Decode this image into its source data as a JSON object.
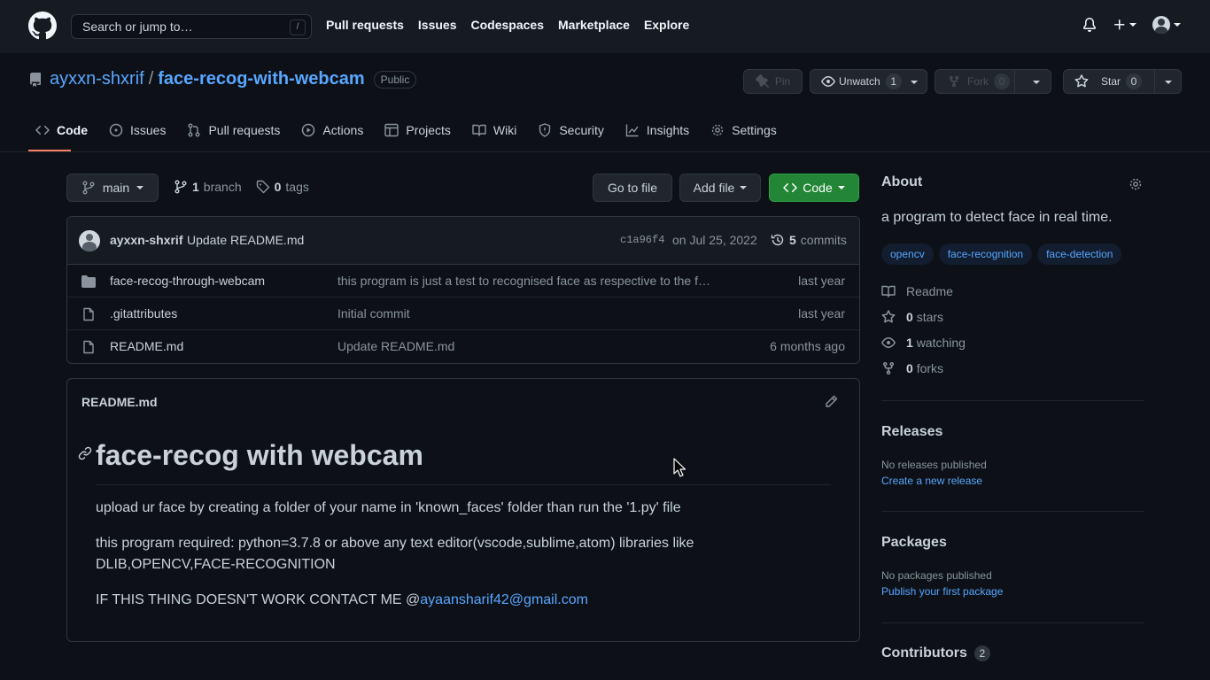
{
  "header": {
    "search_placeholder": "Search or jump to…",
    "search_shortcut": "/",
    "nav": [
      "Pull requests",
      "Issues",
      "Codespaces",
      "Marketplace",
      "Explore"
    ]
  },
  "repo": {
    "owner": "ayxxn-shxrif",
    "separator": "/",
    "name": "face-recog-with-webcam",
    "visibility": "Public",
    "pin_label": "Pin",
    "watch_label": "Unwatch",
    "watch_count": "1",
    "fork_label": "Fork",
    "fork_count": "0",
    "star_label": "Star",
    "star_count": "0"
  },
  "tabs": [
    {
      "label": "Code",
      "icon": "code-icon"
    },
    {
      "label": "Issues",
      "icon": "issue-icon"
    },
    {
      "label": "Pull requests",
      "icon": "pull-request-icon"
    },
    {
      "label": "Actions",
      "icon": "play-icon"
    },
    {
      "label": "Projects",
      "icon": "table-icon"
    },
    {
      "label": "Wiki",
      "icon": "book-icon"
    },
    {
      "label": "Security",
      "icon": "shield-icon"
    },
    {
      "label": "Insights",
      "icon": "graph-icon"
    },
    {
      "label": "Settings",
      "icon": "gear-icon"
    }
  ],
  "branchbar": {
    "branch": "main",
    "branch_count": "1",
    "branch_label": "branch",
    "tag_count": "0",
    "tag_label": "tags",
    "goto_label": "Go to file",
    "addfile_label": "Add file",
    "code_label": "Code"
  },
  "latest_commit": {
    "author": "ayxxn-shxrif",
    "message": "Update README.md",
    "sha": "c1a96f4",
    "date": "on Jul 25, 2022",
    "commit_count": "5",
    "commit_label": "commits"
  },
  "files": [
    {
      "type": "folder",
      "name": "face-recog-through-webcam",
      "message": "this program is just a test to recognised face as respective to the f…",
      "age": "last year"
    },
    {
      "type": "file",
      "name": ".gitattributes",
      "message": "Initial commit",
      "age": "last year"
    },
    {
      "type": "file",
      "name": "README.md",
      "message": "Update README.md",
      "age": "6 months ago"
    }
  ],
  "readme": {
    "filename": "README.md",
    "heading": "face-recog with webcam",
    "p1": "upload ur face by creating a folder of your name in 'known_faces' folder than run the '1.py' file",
    "p2": "this program required: python=3.7.8 or above any text editor(vscode,sublime,atom) libraries like DLIB,OPENCV,FACE-RECOGNITION",
    "p3_prefix": "IF THIS THING DOESN'T WORK CONTACT ME @",
    "p3_link": "ayaansharif42@gmail.com"
  },
  "about": {
    "title": "About",
    "description": "a program to detect face in real time.",
    "topics": [
      "opencv",
      "face-recognition",
      "face-detection"
    ],
    "readme_label": "Readme",
    "stars_count": "0",
    "stars_label": "stars",
    "watching_count": "1",
    "watching_label": "watching",
    "forks_count": "0",
    "forks_label": "forks"
  },
  "releases": {
    "title": "Releases",
    "empty": "No releases published",
    "link": "Create a new release"
  },
  "packages": {
    "title": "Packages",
    "empty": "No packages published",
    "link": "Publish your first package"
  },
  "contributors": {
    "title": "Contributors",
    "count": "2"
  },
  "colors": {
    "bg": "#0d1117",
    "header_bg": "#161b22",
    "accent_link": "#58a6ff",
    "code_button": "#238636",
    "tab_underline": "#f78166"
  }
}
